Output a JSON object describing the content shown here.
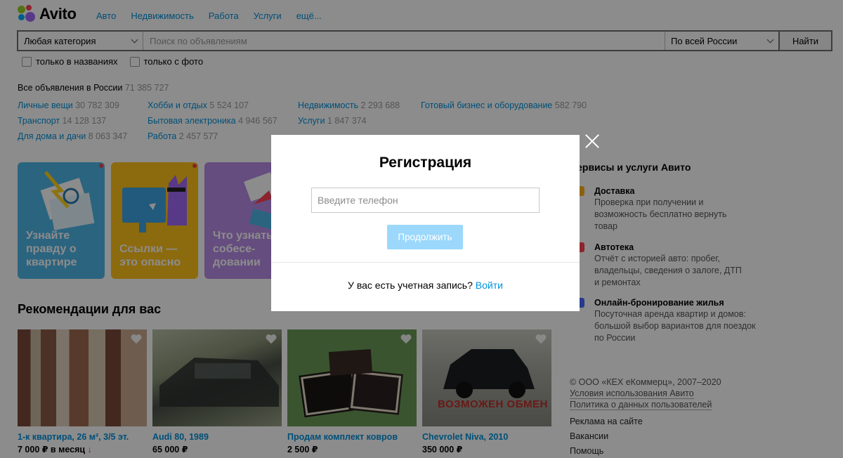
{
  "header": {
    "logo_text": "Avito",
    "nav": [
      "Авто",
      "Недвижимость",
      "Работа",
      "Услуги",
      "ещё..."
    ]
  },
  "search": {
    "category": "Любая категория",
    "placeholder": "Поиск по объявлениям",
    "region": "По всей России",
    "button": "Найти",
    "filters": [
      "только в названиях",
      "только с фото"
    ]
  },
  "stats": {
    "label": "Все объявления в России",
    "count": "71 385 727",
    "columns": [
      [
        {
          "name": "Личные вещи",
          "count": "30 782 309"
        },
        {
          "name": "Транспорт",
          "count": "14 128 137"
        },
        {
          "name": "Для дома и дачи",
          "count": "8 063 347"
        }
      ],
      [
        {
          "name": "Хобби и отдых",
          "count": "5 524 107"
        },
        {
          "name": "Бытовая электроника",
          "count": "4 946 567"
        },
        {
          "name": "Работа",
          "count": "2 457 577"
        }
      ],
      [
        {
          "name": "Недвижимость",
          "count": "2 293 688"
        },
        {
          "name": "Услуги",
          "count": "1 847 374"
        }
      ],
      [
        {
          "name": "Готовый бизнес и оборудование",
          "count": "582 790"
        }
      ]
    ]
  },
  "promos": [
    {
      "text": "Узнайте правду о квартире",
      "color": "#4fb6e8"
    },
    {
      "text": "Ссылки — это опасно",
      "color": "#ffc21a"
    },
    {
      "text": "Что узнать на собесе­довании",
      "color": "#b88ce8"
    }
  ],
  "recommendations": {
    "title": "Рекомендации для вас",
    "items": [
      {
        "title": "1-к квартира, 26 м², 3/5 эт.",
        "price": "7 000 ₽ в месяц",
        "arrow": "↓"
      },
      {
        "title": "Audi 80, 1989",
        "price": "65 000 ₽"
      },
      {
        "title": "Продам комплект ковров",
        "price": "2 500 ₽"
      },
      {
        "title": "Chevrolet Niva, 2010",
        "price": "350 000 ₽",
        "overlay_text": "ВОЗМОЖЕН ОБМЕН"
      }
    ]
  },
  "services": {
    "title": "Сервисы и услуги Авито",
    "items": [
      {
        "name": "Доставка",
        "desc": "Проверка при получении и возможность бесплатно вернуть товар"
      },
      {
        "name": "Автотека",
        "desc": "Отчёт с историей авто: пробег, владельцы, сведения о залоге, ДТП и ремонтах"
      },
      {
        "name": "Онлайн-бронирование жилья",
        "desc": "Посуточная аренда квартир и домов: большой выбор вариантов для поездок по России"
      }
    ]
  },
  "footer": {
    "copyright": "© ООО «КЕХ еКоммерц», 2007–2020",
    "links": [
      "Условия использования Авито",
      "Политика о данных пользователей"
    ],
    "extra": [
      "Реклама на сайте",
      "Вакансии",
      "Помощь"
    ]
  },
  "modal": {
    "title": "Регистрация",
    "phone_placeholder": "Введите телефон",
    "continue": "Продолжить",
    "have_account": "У вас есть учетная запись?",
    "login": "Войти"
  },
  "colors": {
    "link": "#0091d9",
    "continue_button": "#9bd8fb"
  }
}
